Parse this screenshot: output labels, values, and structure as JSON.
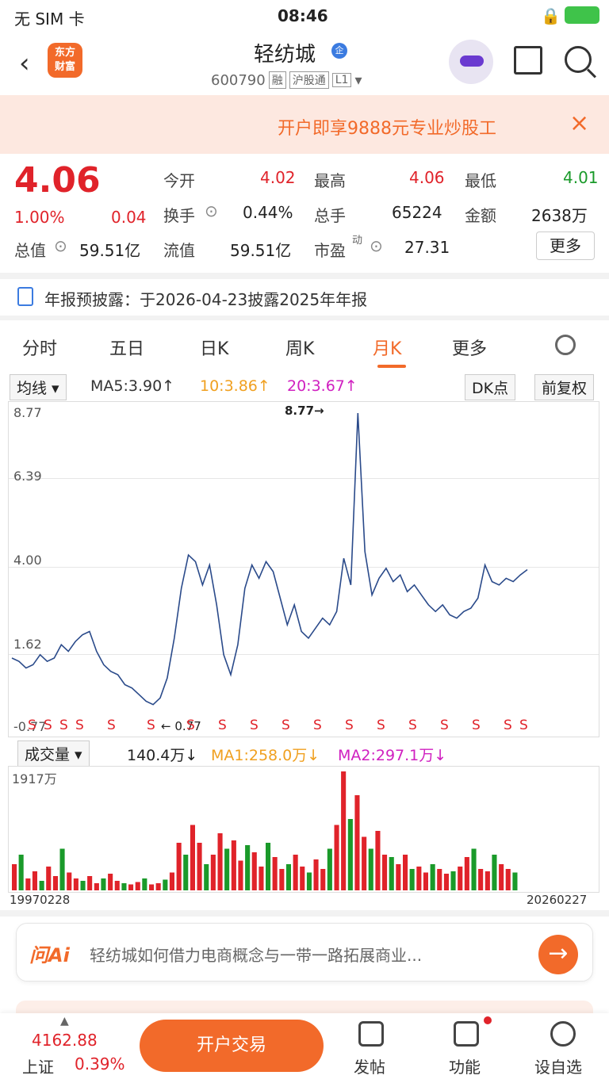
{
  "status_bar": {
    "carrier": "无 SIM 卡",
    "time": "08:46"
  },
  "header": {
    "logo_text_1": "东方",
    "logo_text_2": "财富",
    "title": "轻纺城",
    "badge": "企",
    "code": "600790",
    "tags": [
      "融",
      "沪股通",
      "L1"
    ]
  },
  "promo": {
    "text": "开户即享9888元专业炒股工",
    "close": "×"
  },
  "quote": {
    "price": "4.06",
    "change_pct": "1.00%",
    "change": "0.04",
    "fields": [
      {
        "label": "今开",
        "value": "4.02",
        "color": "#e0232a"
      },
      {
        "label": "最高",
        "value": "4.06",
        "color": "#e0232a"
      },
      {
        "label": "最低",
        "value": "4.01",
        "color": "#1a9a2a"
      },
      {
        "label": "换手",
        "value": "0.44%",
        "color": "#222222"
      },
      {
        "label": "总手",
        "value": "65224",
        "color": "#222222"
      },
      {
        "label": "金额",
        "value": "2638万",
        "color": "#222222"
      },
      {
        "label": "总值",
        "value": "59.51亿",
        "color": "#222222"
      },
      {
        "label": "流值",
        "value": "59.51亿",
        "color": "#222222"
      },
      {
        "label": "市盈",
        "value": "27.31",
        "color": "#222222"
      }
    ],
    "pe_superscript": "动",
    "more_button": "更多"
  },
  "notice": {
    "text": "年报预披露：于2026-04-23披露2025年年报"
  },
  "tabs": {
    "items": [
      "分时",
      "五日",
      "日K",
      "周K",
      "月K",
      "更多"
    ],
    "active": "月K"
  },
  "indicators": {
    "selector": "均线",
    "ma5": "MA5:3.90↑",
    "ma10": "10:3.86↑",
    "ma20": "20:3.67↑",
    "dk": "DK点",
    "adjust": "前复权"
  },
  "chart_data": {
    "type": "line",
    "y_ticks": [
      "8.77",
      "6.39",
      "4.00",
      "1.62",
      "-0.77"
    ],
    "ylim": [
      -0.77,
      8.77
    ],
    "peak_label": "8.77→",
    "low_label": "← 0.77",
    "x_start": "19970228",
    "x_end": "20260227",
    "signal_marker": "S",
    "series": [
      {
        "values": [
          1.4,
          1.3,
          1.1,
          1.2,
          1.5,
          1.3,
          1.4,
          1.8,
          1.6,
          1.9,
          2.1,
          2.2,
          1.6,
          1.2,
          1.0,
          0.9,
          0.6,
          0.5,
          0.3,
          0.1,
          0.0,
          0.2,
          0.8,
          2.0,
          3.5,
          4.5,
          4.3,
          3.6,
          4.2,
          3.0,
          1.5,
          0.9,
          1.8,
          3.5,
          4.2,
          3.8,
          4.3,
          4.0,
          3.2,
          2.4,
          3.0,
          2.2,
          2.0,
          2.3,
          2.6,
          2.4,
          2.8,
          4.4,
          3.6,
          8.77,
          4.6,
          3.3,
          3.8,
          4.1,
          3.7,
          3.9,
          3.4,
          3.6,
          3.3,
          3.0,
          2.8,
          3.0,
          2.7,
          2.6,
          2.8,
          2.9,
          3.2,
          4.2,
          3.7,
          3.6,
          3.8,
          3.7,
          3.9,
          4.06
        ]
      }
    ]
  },
  "volume": {
    "selector": "成交量",
    "value": "140.4万↓",
    "ma1": "MA1:258.0万↓",
    "ma2": "MA2:297.1万↓",
    "max_label": "1917万",
    "bars": [
      0.22,
      0.3,
      0.1,
      0.16,
      0.08,
      0.2,
      0.12,
      0.35,
      0.15,
      0.1,
      0.08,
      0.12,
      0.06,
      0.1,
      0.14,
      0.08,
      0.06,
      0.05,
      0.07,
      0.1,
      0.05,
      0.06,
      0.09,
      0.15,
      0.4,
      0.3,
      0.55,
      0.4,
      0.22,
      0.3,
      0.48,
      0.35,
      0.42,
      0.25,
      0.38,
      0.32,
      0.2,
      0.4,
      0.28,
      0.18,
      0.22,
      0.3,
      0.2,
      0.15,
      0.26,
      0.18,
      0.35,
      0.55,
      1.0,
      0.6,
      0.8,
      0.45,
      0.35,
      0.5,
      0.3,
      0.28,
      0.22,
      0.3,
      0.18,
      0.2,
      0.15,
      0.22,
      0.18,
      0.14,
      0.16,
      0.2,
      0.28,
      0.35,
      0.18,
      0.16,
      0.3,
      0.22,
      0.18,
      0.15
    ]
  },
  "ai": {
    "brand": "问Ai",
    "question": "轻纺城如何借力电商概念与一带一路拓展商业..."
  },
  "bottom": {
    "index_value": "4162.88",
    "index_name": "上证",
    "index_pct": "0.39%",
    "trade_button": "开户交易",
    "items": [
      "发帖",
      "功能",
      "设自选"
    ]
  },
  "colors": {
    "accent": "#f26a2a",
    "up": "#e0232a",
    "down": "#1a9a2a",
    "line": "#2a4a8a"
  }
}
